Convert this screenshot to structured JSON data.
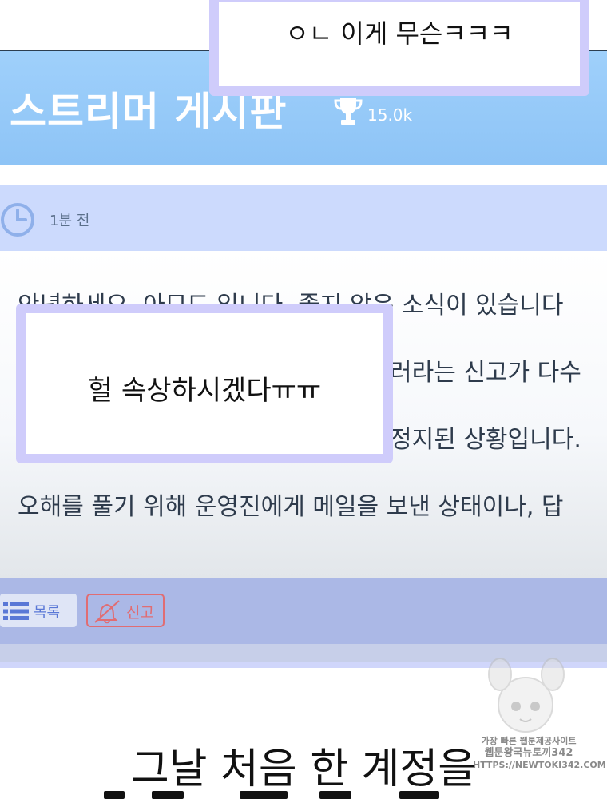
{
  "top_bubble": {
    "text": "ㅇㄴ 이게 무슨ㅋㅋㅋ"
  },
  "board": {
    "title": "스트리머 게시판",
    "trophy_count": "15.0k"
  },
  "post": {
    "time_ago": "1분 전",
    "lines": [
      "안녕하세요. 아모드 입니다. 좋지 않은 소식이 있습니다",
      "러라는 신고가 다수 ",
      "정지된 상황입니다.",
      "오해를 풀기 위해 운영진에게 메일을 보낸 상태이나, 답"
    ]
  },
  "mid_bubble": {
    "text": "헐 속상하시겠다ㅠㅠ"
  },
  "footer": {
    "list_label": "목록",
    "report_label": "신고"
  },
  "caption": {
    "line1": "그날 처음 한 계정을"
  },
  "watermark": {
    "line1": "가장 빠른 웹툰제공사이트",
    "line2": "웹툰왕국뉴토끼342",
    "line3": "HTTPS://NEWTOKI342.COM"
  },
  "colors": {
    "header_blue": "#9fd0fb",
    "meta_bar": "#ccdafd",
    "footer_bar": "#abb8e6",
    "bubble_border": "#cfccfb",
    "report_red": "#e06d73",
    "list_blue": "#5a78d6"
  },
  "icons": [
    "trophy-icon",
    "clock-icon",
    "list-icon",
    "bell-off-icon"
  ]
}
